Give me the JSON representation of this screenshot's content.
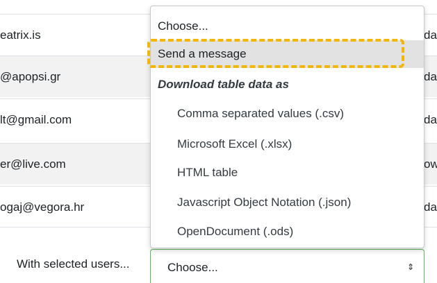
{
  "table": {
    "rows": [
      {
        "email": "eatrix.is",
        "tail": "da"
      },
      {
        "email": "@apopsi.gr",
        "tail": "da"
      },
      {
        "email": "lt@gmail.com",
        "tail": "da"
      },
      {
        "email": "er@live.com",
        "tail": "ow"
      },
      {
        "email": "ogaj@vegora.hr",
        "tail": "da"
      }
    ]
  },
  "bulk_action": {
    "label": "With selected users...",
    "select_value": "Choose...",
    "arrow": "⇕"
  },
  "menu": {
    "choose": "Choose...",
    "send_message": "Send a message",
    "download_header": "Download table data as",
    "formats": [
      "Comma separated values (.csv)",
      "Microsoft Excel (.xlsx)",
      "HTML table",
      "Javascript Object Notation (.json)",
      "OpenDocument (.ods)"
    ]
  },
  "colors": {
    "highlight_bg": "#e2e2e2",
    "focus_outline": "#f2b705",
    "select_border": "#5cb85c",
    "stripe": "#f2f2f2"
  }
}
